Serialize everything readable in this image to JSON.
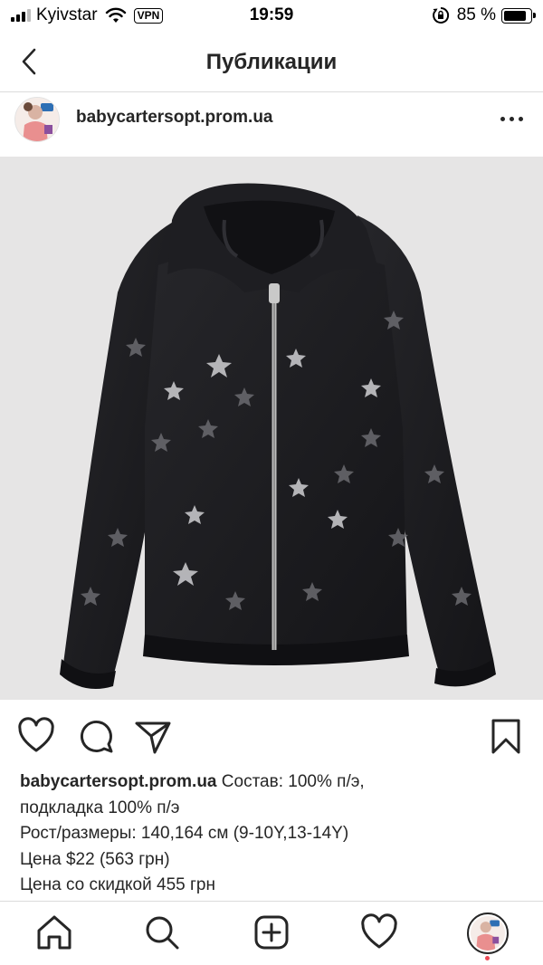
{
  "status_bar": {
    "carrier": "Kyivstar",
    "vpn": "VPN",
    "time": "19:59",
    "battery": "85 %",
    "battery_level": 0.85
  },
  "nav": {
    "title": "Публикации"
  },
  "post": {
    "username": "babycartersopt.prom.ua"
  },
  "caption": {
    "username": "babycartersopt.prom.ua",
    "line1": "Состав: 100% п/э,",
    "line2": "подкладка 100% п/э",
    "line3": "Рост/размеры: 140,164 см (9-10Y,13-14Y)",
    "line4": "Цена $22 (563 грн)",
    "line5": "Цена со скидкой 455 грн"
  },
  "colors": {
    "text": "#262626",
    "separator": "#dbdbdb",
    "photo_bg": "#e6e5e5",
    "jacket": "#1c1c1f",
    "notification_dot": "#ed4956"
  }
}
